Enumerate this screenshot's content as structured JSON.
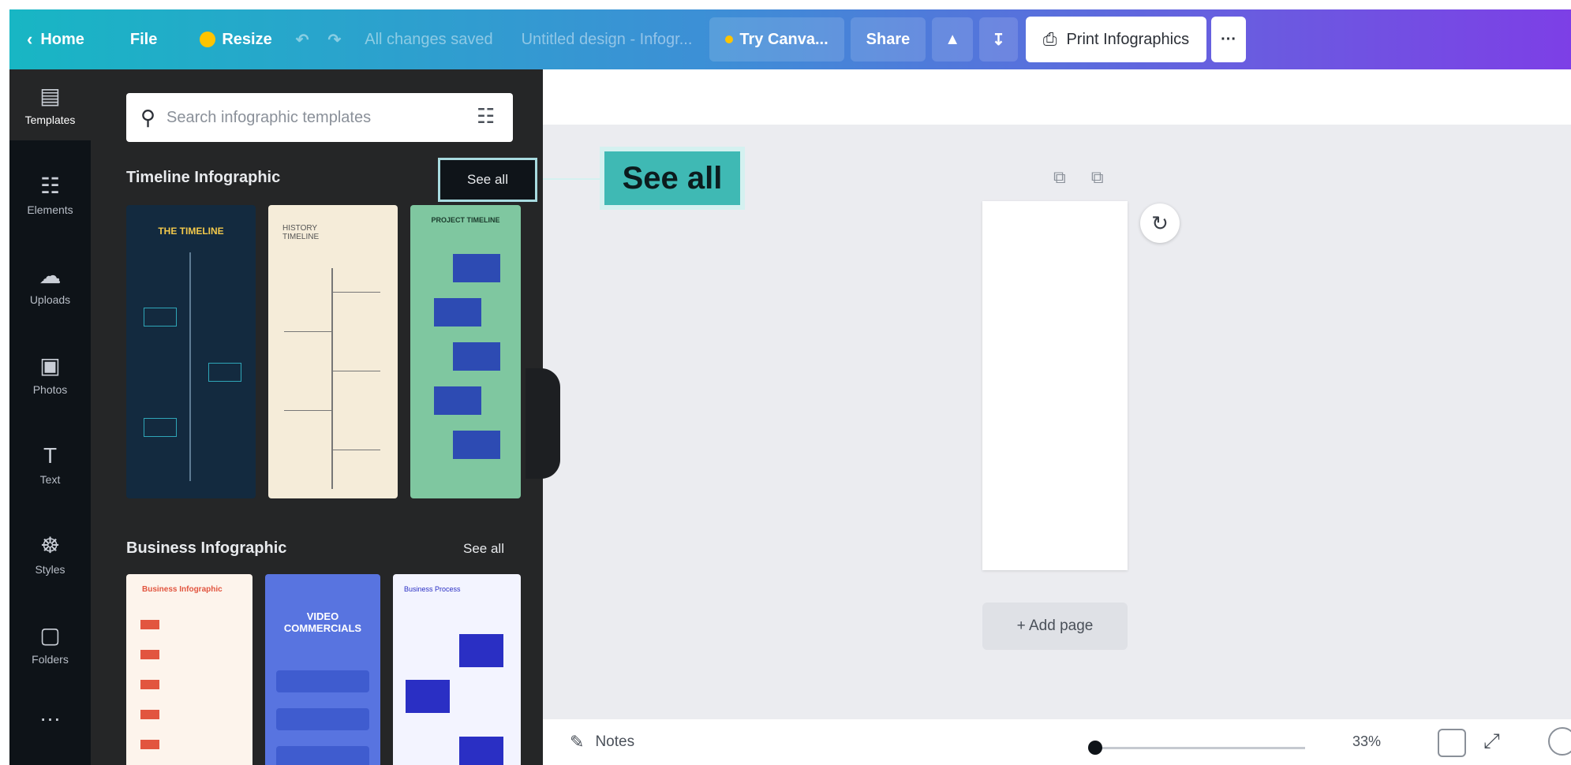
{
  "topbar": {
    "home": "Home",
    "file": "File",
    "resize": "Resize",
    "status": "All changes saved",
    "title": "Untitled design - Infogr...",
    "try_canva": "Try Canva...",
    "share": "Share",
    "print": "Print Infographics",
    "more": "···"
  },
  "rail": {
    "items": [
      {
        "label": "Templates",
        "icon": "▤"
      },
      {
        "label": "Elements",
        "icon": "☷"
      },
      {
        "label": "Uploads",
        "icon": "☁"
      },
      {
        "label": "Photos",
        "icon": "▣"
      },
      {
        "label": "Text",
        "icon": "T"
      },
      {
        "label": "Styles",
        "icon": "☸"
      },
      {
        "label": "Folders",
        "icon": "▢"
      }
    ],
    "more": "…"
  },
  "panel": {
    "search_placeholder": "Search infographic templates",
    "sections": [
      {
        "title": "Timeline Infographic",
        "see_all": "See all"
      },
      {
        "title": "Business Infographic",
        "see_all": "See all"
      }
    ]
  },
  "thumbnails": {
    "timeline": [
      {
        "title": "THE TIMELINE",
        "bg": "#132a3f"
      },
      {
        "title": "HISTORY TIMELINE",
        "bg": "#f5ecd9"
      },
      {
        "title": "PROJECT TIMELINE",
        "bg": "#7fc7a0"
      }
    ],
    "business": [
      {
        "title": "Business Infographic",
        "bg": "#fdf4ec"
      },
      {
        "title": "VIDEO COMMERCIALS",
        "bg": "#5874e0"
      },
      {
        "title": "Business Process",
        "bg": "#f3f4ff"
      }
    ]
  },
  "callout": {
    "text": "See all"
  },
  "canvas": {
    "add_page": "+ Add page"
  },
  "bottombar": {
    "notes": "Notes",
    "zoom": "33%",
    "zoom_fraction": 0.0
  },
  "colors": {
    "accent_teal": "#3fb9b4",
    "rail_bg": "#0e1318",
    "panel_bg": "#252627"
  }
}
